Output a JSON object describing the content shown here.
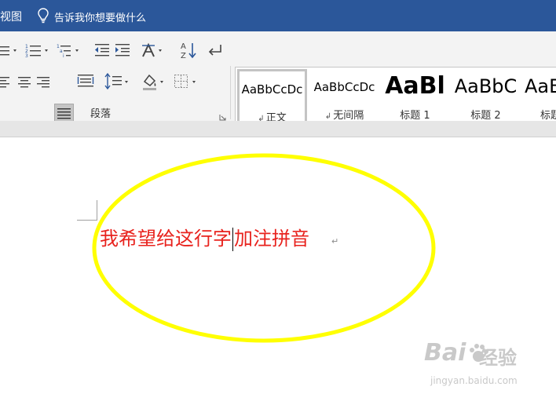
{
  "topbar": {
    "tab_label": "视图",
    "tellme_placeholder": "告诉我你想要做什么"
  },
  "ribbon": {
    "paragraph_group_label": "段落",
    "styles": [
      {
        "preview": "AaBbCcDc",
        "name": "正文",
        "para_mark": "↲",
        "selected": true
      },
      {
        "preview": "AaBbCcDc",
        "name": "无间隔",
        "para_mark": "↲",
        "selected": false
      },
      {
        "preview": "AaBl",
        "name": "标题 1",
        "para_mark": "",
        "selected": false
      },
      {
        "preview": "AaBbC",
        "name": "标题 2",
        "para_mark": "",
        "selected": false
      },
      {
        "preview": "AaB",
        "name": "标题",
        "para_mark": "",
        "selected": false
      }
    ]
  },
  "document": {
    "text_before_caret": "我希望给这行字",
    "text_after_caret": "加注拼音",
    "para_mark": "↵",
    "text_color": "#e8221d",
    "highlight_color": "#ffff00"
  },
  "watermark": {
    "brand": "Bai",
    "brand_suffix": "经验",
    "url": "jingyan.baidu.com"
  },
  "colors": {
    "title_bar": "#2b579a",
    "ribbon_bg": "#f3f3f3"
  }
}
